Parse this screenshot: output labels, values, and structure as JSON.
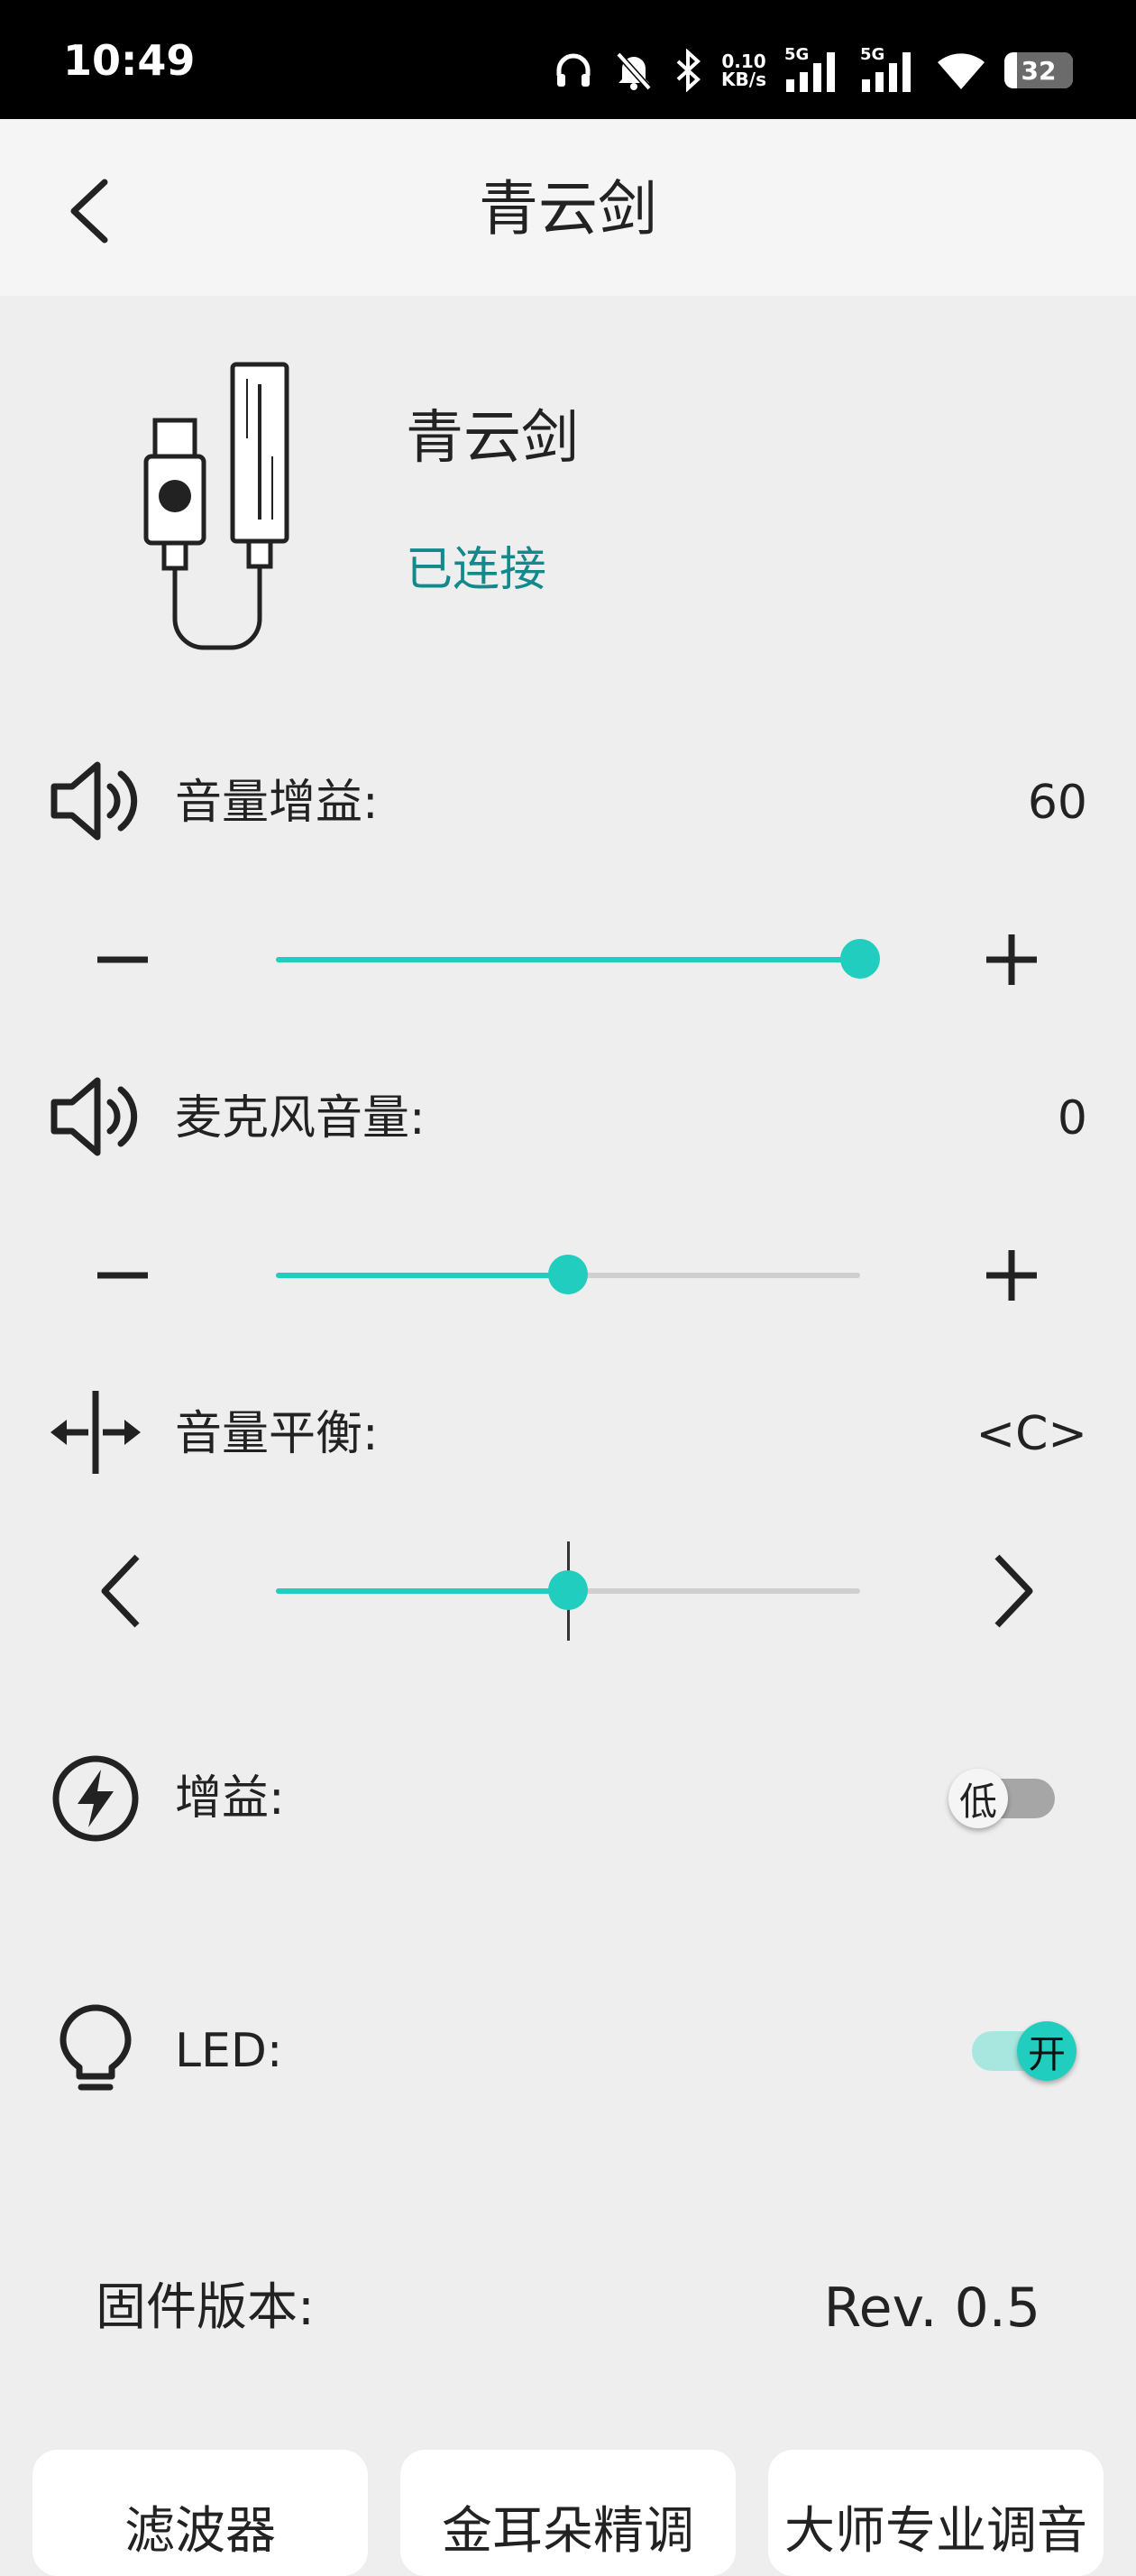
{
  "status_bar": {
    "time": "10:49",
    "net_speed_value": "0.10",
    "net_speed_unit": "KB/s",
    "signal_1_label": "5G",
    "signal_2_label": "5G",
    "battery": "32"
  },
  "header": {
    "title": "青云剑"
  },
  "device": {
    "name": "青云剑",
    "status": "已连接"
  },
  "volume_gain": {
    "label": "音量增益:",
    "value": "60",
    "level": 1.0
  },
  "mic_volume": {
    "label": "麦克风音量:",
    "value": "0",
    "level": 0.5
  },
  "balance": {
    "label": "音量平衡:",
    "value": "<C>",
    "level": 0.5
  },
  "gain": {
    "label": "增益:",
    "toggle_text": "低",
    "on": false
  },
  "led": {
    "label": "LED:",
    "toggle_text": "开",
    "on": true
  },
  "firmware": {
    "label": "固件版本:",
    "value": "Rev. 0.5"
  },
  "bottom_tabs": [
    {
      "label": "滤波器"
    },
    {
      "label": "金耳朵精调"
    },
    {
      "label": "大师专业调音"
    }
  ],
  "colors": {
    "accent": "#20cdbf",
    "status_text": "#12898a"
  }
}
